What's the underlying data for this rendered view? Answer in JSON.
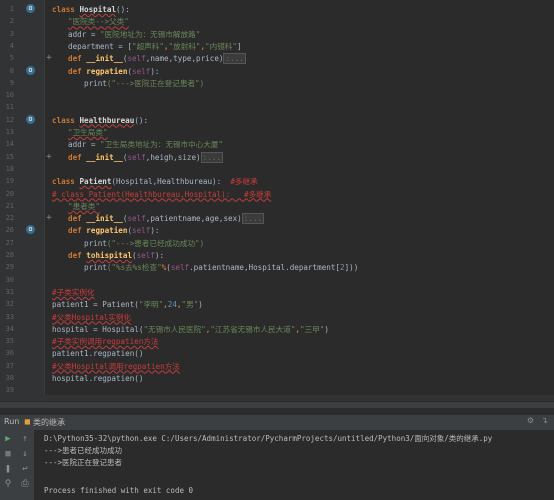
{
  "lines": [
    {
      "n": "1",
      "mark": "ovr"
    },
    {
      "n": "2"
    },
    {
      "n": "3"
    },
    {
      "n": "4"
    },
    {
      "n": "5",
      "mark": "plus"
    },
    {
      "n": "8",
      "mark": "ovr"
    },
    {
      "n": "9"
    },
    {
      "n": "10"
    },
    {
      "n": "11"
    },
    {
      "n": "12",
      "mark": "ovr"
    },
    {
      "n": "13"
    },
    {
      "n": "14"
    },
    {
      "n": "15",
      "mark": "plus"
    },
    {
      "n": "18"
    },
    {
      "n": "19"
    },
    {
      "n": "20"
    },
    {
      "n": "21"
    },
    {
      "n": "22",
      "mark": "plus"
    },
    {
      "n": "26",
      "mark": "ovr"
    },
    {
      "n": "27"
    },
    {
      "n": "28"
    },
    {
      "n": "29"
    },
    {
      "n": "30"
    },
    {
      "n": "31"
    },
    {
      "n": "32"
    },
    {
      "n": "33"
    },
    {
      "n": "34"
    },
    {
      "n": "35"
    },
    {
      "n": "36"
    },
    {
      "n": "37"
    },
    {
      "n": "38"
    },
    {
      "n": "39"
    }
  ],
  "code": {
    "l1_kw": "class ",
    "l1_name": "Hospital",
    "l1_rest": "():",
    "l2": "\"医院类-->父类\"",
    "l3_var": "addr = ",
    "l3_str": "\"医院地址为：无锡市解放路\"",
    "l4_var": "department = [",
    "l4_s1": "\"超声科\"",
    "l4_c1": ",",
    "l4_s2": "\"放射科\"",
    "l4_c2": ",",
    "l4_s3": "\"内镜科\"",
    "l4_end": "]",
    "l5_kw": "def ",
    "l5_fn": "__init__",
    "l5_open": "(",
    "l5_self": "self",
    "l5_args": ",name,type,price)",
    "l5_fold": ":...",
    "l8_kw": "def ",
    "l8_fn": "regpatien",
    "l8_open": "(",
    "l8_self": "self",
    "l8_close": "):",
    "l9_kw": "print",
    "l9_str": "(\"--->医院正在登记患者\")",
    "l12_kw": "class ",
    "l12_name": "Healthbureau",
    "l12_rest": "():",
    "l13": "\"卫生局类\"",
    "l14_var": "addr = ",
    "l14_str": "\"卫生局类地址为：无锡市中心大厦\"",
    "l15_kw": "def ",
    "l15_fn": "__init__",
    "l15_open": "(",
    "l15_self": "self",
    "l15_args": ",heigh,size)",
    "l15_fold": ":...",
    "l19_kw": "class ",
    "l19_name": "Patient",
    "l19_args": "(Hospital,Healthbureau):",
    "l19_cm": "  #多继承",
    "l20": "# class Patient(Healthbureau,Hospital):   #多继承",
    "l21": "\"患者类\"",
    "l22_kw": "def ",
    "l22_fn": "__init__",
    "l22_open": "(",
    "l22_self": "self",
    "l22_args": ",patientname,age,sex)",
    "l22_fold": ":...",
    "l26_kw": "def ",
    "l26_fn": "regpatien",
    "l26_open": "(",
    "l26_self": "self",
    "l26_close": "):",
    "l27_kw": "print",
    "l27_str": "(\"--->患者已经成功成功\")",
    "l28_kw": "def ",
    "l28_fn": "tohispital",
    "l28_open": "(",
    "l28_self": "self",
    "l28_close": "):",
    "l29_kw": "print",
    "l29_str": "(\"%s去%s检查\"",
    "l29_pct": "%",
    "l29_p1": "(",
    "l29_self": "self",
    "l29_rest": ".patientname,Hospital.department[",
    "l29_num": "2",
    "l29_end": "]))",
    "l31": "#子类实例化",
    "l32_var": "patient1 = Patient(",
    "l32_s1": "\"李明\"",
    "l32_c1": ",",
    "l32_n": "24",
    "l32_c2": ",",
    "l32_s2": "\"男\"",
    "l32_end": ")",
    "l33": "#父类Hospital实例化",
    "l34_var": "hospital = Hospital(",
    "l34_s1": "\"无锡市人民医院\"",
    "l34_c1": ",",
    "l34_s2": "\"江苏省无锡市人民大道\"",
    "l34_c2": ",",
    "l34_s3": "\"三甲\"",
    "l34_end": ")",
    "l35": "#子类实例调用regpatien方法",
    "l36": "patient1.regpatien()",
    "l37": "#父类Hospital调用regpatien方法",
    "l38": "hospital.regpatien()"
  },
  "run": {
    "label": "Run",
    "tab": "类的继承",
    "cmd": "D:\\Python35-32\\python.exe C:/Users/Administrator/PycharmProjects/untitled/Python3/面向对象/类的继承.py",
    "out1": "--->患者已经成功成功",
    "out2": "--->医院正在登记患者",
    "exit": "Process finished with exit code 0"
  },
  "colors": {
    "background": "#2b2b2b",
    "keyword": "#cc7832",
    "function": "#ffc66d",
    "string": "#6a8759",
    "self": "#94558d",
    "comment_red": "#cc3b3b"
  }
}
